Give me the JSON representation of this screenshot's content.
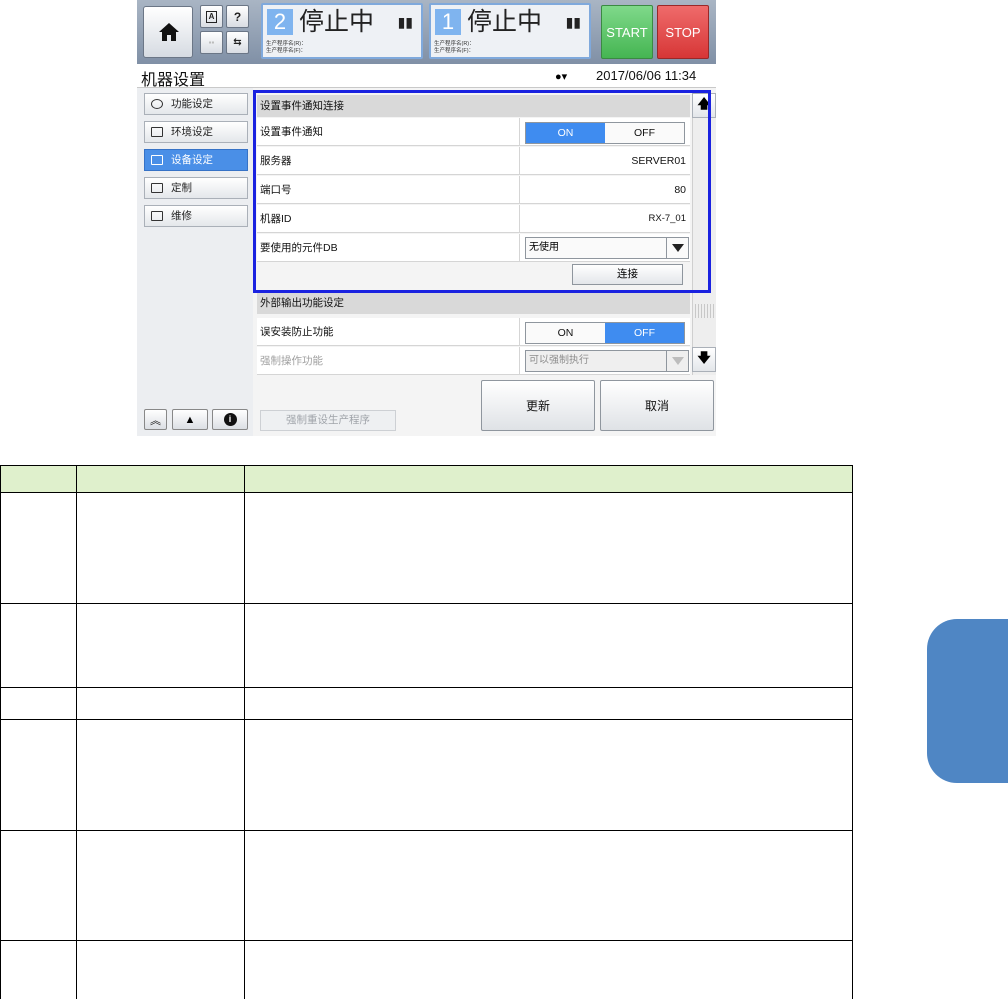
{
  "topbar": {
    "lane_2": {
      "number": "2",
      "status": "停止中",
      "prog_r": "生产程序名(R)：",
      "prog_f": "生产程序名(F)："
    },
    "lane_1": {
      "number": "1",
      "status": "停止中",
      "prog_r": "生产程序名(R)：",
      "prog_f": "生产程序名(F)："
    },
    "start_label": "START",
    "stop_label": "STOP",
    "help_label": "?"
  },
  "title": "机器设置",
  "datetime": "2017/06/06 11:34",
  "sidebar": {
    "items": [
      {
        "label": "功能设定",
        "active": false
      },
      {
        "label": "环境设定",
        "active": false
      },
      {
        "label": "设备设定",
        "active": true
      },
      {
        "label": "定制",
        "active": false
      },
      {
        "label": "维修",
        "active": false
      }
    ]
  },
  "section1": {
    "header": "设置事件通知连接",
    "event_notify": {
      "label": "设置事件通知",
      "on": "ON",
      "off": "OFF",
      "selected": "ON"
    },
    "server": {
      "label": "服务器",
      "value": "SERVER01"
    },
    "port": {
      "label": "端口号",
      "value": "80"
    },
    "machine_id": {
      "label": "机器ID",
      "value": "RX-7_01"
    },
    "component_db": {
      "label": "要使用的元件DB",
      "value": "无使用"
    },
    "connect_label": "连接"
  },
  "section2": {
    "header": "外部输出功能设定",
    "mismount": {
      "label": "误安装防止功能",
      "on": "ON",
      "off": "OFF",
      "selected": "OFF"
    },
    "force_op": {
      "label": "强制操作功能",
      "value": "可以强制执行"
    }
  },
  "buttons": {
    "update": "更新",
    "cancel": "取消",
    "reset_program": "强制重设生产程序"
  },
  "colors": {
    "accent": "#4a8fe7",
    "highlight_frame": "#1a22e0",
    "table_header": "#dff0cc",
    "side_tab": "#4f86c4"
  }
}
